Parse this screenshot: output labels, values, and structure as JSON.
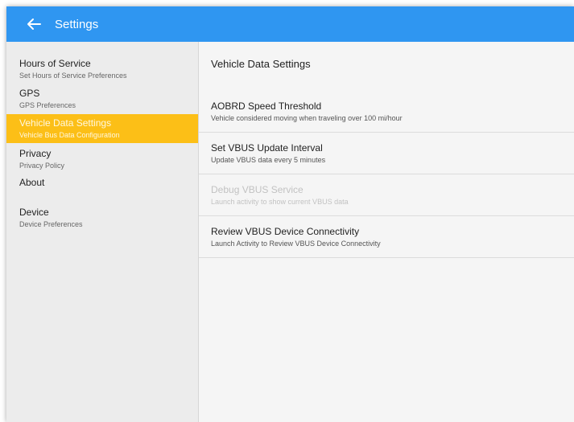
{
  "appbar": {
    "back_icon": "arrow-left-icon",
    "title": "Settings",
    "color": "#2f96f1"
  },
  "sidebar": {
    "active_color": "#fcbf17",
    "items": [
      {
        "label": "Hours of Service",
        "sub": "Set Hours of Service Preferences"
      },
      {
        "label": "GPS",
        "sub": "GPS Preferences"
      },
      {
        "label": "Vehicle Data Settings",
        "sub": "Vehicle Bus Data Configuration"
      },
      {
        "label": "Privacy",
        "sub": "Privacy Policy"
      },
      {
        "label": "About",
        "sub": ""
      },
      {
        "label": "Device",
        "sub": "Device Preferences"
      }
    ]
  },
  "main": {
    "section_title": "Vehicle Data Settings",
    "items": [
      {
        "label": "AOBRD Speed Threshold",
        "sub": "Vehicle considered moving when traveling over 100 mi/hour"
      },
      {
        "label": "Set VBUS Update Interval",
        "sub": "Update VBUS data every 5 minutes"
      },
      {
        "label": "Debug VBUS Service",
        "sub": "Launch activity to show current VBUS data"
      },
      {
        "label": "Review VBUS Device Connectivity",
        "sub": "Launch Activity to Review VBUS Device Connectivity"
      }
    ]
  }
}
